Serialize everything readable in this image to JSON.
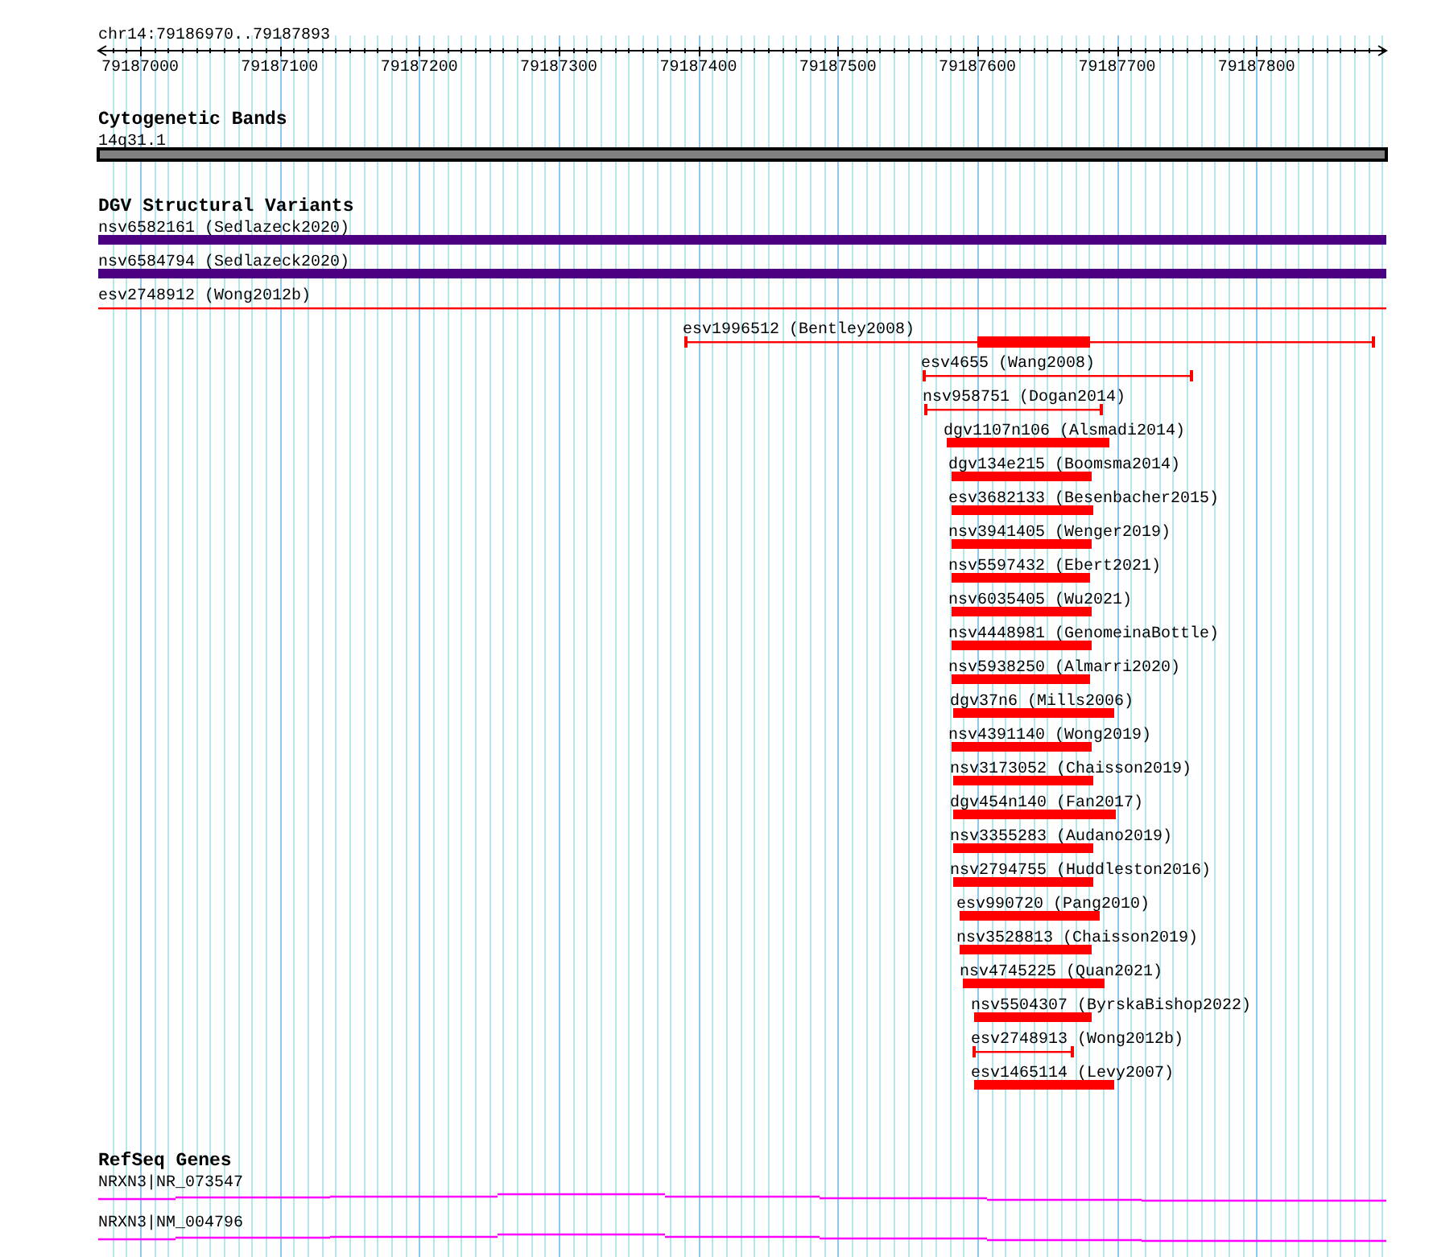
{
  "ruler": {
    "title": "chr14:79186970..79187893",
    "ticks": [
      "79187000",
      "79187100",
      "79187200",
      "79187300",
      "79187400",
      "79187500",
      "79187600",
      "79187700",
      "79187800"
    ]
  },
  "tracks": [
    {
      "title": "Cytogenetic Bands",
      "kind": "bands",
      "features": [
        {
          "label": "14q31.1"
        }
      ]
    },
    {
      "title": "DGV Structural Variants",
      "kind": "variants",
      "features": [
        {
          "label": "nsv6582161 (Sedlazeck2020)",
          "kind": "thick",
          "color": "#4b0082"
        },
        {
          "label": "nsv6584794 (Sedlazeck2020)",
          "kind": "thick",
          "color": "#4b0082"
        },
        {
          "label": "esv2748912 (Wong2012b)",
          "kind": "range",
          "color": "#ff0000"
        },
        {
          "label": "esv1996512 (Bentley2008)",
          "kind": "range",
          "color": "#ff0000"
        },
        {
          "label": "esv4655 (Wang2008)",
          "kind": "range",
          "color": "#ff0000"
        },
        {
          "label": "nsv958751 (Dogan2014)",
          "kind": "range",
          "color": "#ff0000"
        },
        {
          "label": "dgv1107n106 (Alsmadi2014)",
          "kind": "thick",
          "color": "#ff0000"
        },
        {
          "label": "dgv134e215 (Boomsma2014)",
          "kind": "thick",
          "color": "#ff0000"
        },
        {
          "label": "esv3682133 (Besenbacher2015)",
          "kind": "thick",
          "color": "#ff0000"
        },
        {
          "label": "nsv3941405 (Wenger2019)",
          "kind": "thick",
          "color": "#ff0000"
        },
        {
          "label": "nsv5597432 (Ebert2021)",
          "kind": "thick",
          "color": "#ff0000"
        },
        {
          "label": "nsv6035405 (Wu2021)",
          "kind": "thick",
          "color": "#ff0000"
        },
        {
          "label": "nsv4448981 (GenomeinaBottle)",
          "kind": "thick",
          "color": "#ff0000"
        },
        {
          "label": "nsv5938250 (Almarri2020)",
          "kind": "thick",
          "color": "#ff0000"
        },
        {
          "label": "dgv37n6 (Mills2006)",
          "kind": "thick",
          "color": "#ff0000"
        },
        {
          "label": "nsv4391140 (Wong2019)",
          "kind": "thick",
          "color": "#ff0000"
        },
        {
          "label": "nsv3173052 (Chaisson2019)",
          "kind": "thick",
          "color": "#ff0000"
        },
        {
          "label": "dgv454n140 (Fan2017)",
          "kind": "thick",
          "color": "#ff0000"
        },
        {
          "label": "nsv3355283 (Audano2019)",
          "kind": "thick",
          "color": "#ff0000"
        },
        {
          "label": "nsv2794755 (Huddleston2016)",
          "kind": "thick",
          "color": "#ff0000"
        },
        {
          "label": "esv990720 (Pang2010)",
          "kind": "thick",
          "color": "#ff0000"
        },
        {
          "label": "nsv3528813 (Chaisson2019)",
          "kind": "thick",
          "color": "#ff0000"
        },
        {
          "label": "nsv4745225 (Quan2021)",
          "kind": "thick",
          "color": "#ff0000"
        },
        {
          "label": "nsv5504307 (ByrskaBishop2022)",
          "kind": "thick",
          "color": "#ff0000"
        },
        {
          "label": "esv2748913 (Wong2012b)",
          "kind": "range",
          "color": "#ff0000"
        },
        {
          "label": "esv1465114 (Levy2007)",
          "kind": "thick",
          "color": "#ff0000"
        }
      ]
    },
    {
      "title": "RefSeq Genes",
      "kind": "genes",
      "features": [
        {
          "label": "NRXN3|NR_073547"
        },
        {
          "label": "NRXN3|NM_004796"
        }
      ]
    }
  ]
}
